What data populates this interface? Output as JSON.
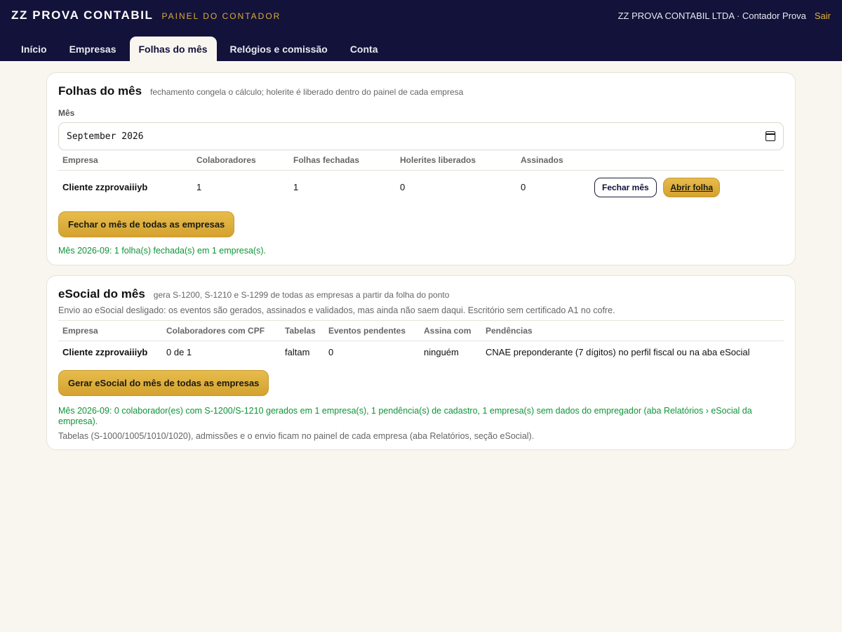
{
  "header": {
    "brand": "ZZ PROVA CONTABIL",
    "subtitle": "PAINEL DO CONTADOR",
    "user": "ZZ PROVA CONTABIL LTDA · Contador Prova",
    "logout": "Sair"
  },
  "tabs": [
    {
      "label": "Início"
    },
    {
      "label": "Empresas"
    },
    {
      "label": "Folhas do mês"
    },
    {
      "label": "Relógios e comissão"
    },
    {
      "label": "Conta"
    }
  ],
  "folhas": {
    "title": "Folhas do mês",
    "hint": "fechamento congela o cálculo; holerite é liberado dentro do painel de cada empresa",
    "month_label": "Mês",
    "month_value": "September 2026",
    "columns": [
      "Empresa",
      "Colaboradores",
      "Folhas fechadas",
      "Holerites liberados",
      "Assinados"
    ],
    "row": {
      "empresa": "Cliente zzprovaiiiyb",
      "colaboradores": "1",
      "folhas_fechadas": "1",
      "holerites": "0",
      "assinados": "0",
      "close_button": "Fechar mês",
      "open_button": "Abrir folha"
    },
    "close_all_button": "Fechar o mês de todas as empresas",
    "status": "Mês 2026-09: 1 folha(s) fechada(s) em 1 empresa(s)."
  },
  "esocial": {
    "title": "eSocial do mês",
    "hint": "gera S-1200, S-1210 e S-1299 de todas as empresas a partir da folha do ponto",
    "notice": "Envio ao eSocial desligado: os eventos são gerados, assinados e validados, mas ainda não saem daqui. Escritório sem certificado A1 no cofre.",
    "columns": [
      "Empresa",
      "Colaboradores com CPF",
      "Tabelas",
      "Eventos pendentes",
      "Assina com",
      "Pendências"
    ],
    "row": {
      "empresa": "Cliente zzprovaiiiyb",
      "cpf": "0 de 1",
      "tabelas": "faltam",
      "eventos": "0",
      "assina": "ninguém",
      "pendencias": "CNAE preponderante (7 dígitos) no perfil fiscal ou na aba eSocial"
    },
    "generate_button": "Gerar eSocial do mês de todas as empresas",
    "status": "Mês 2026-09: 0 colaborador(es) com S-1200/S-1210 gerados em 1 empresa(s), 1 pendência(s) de cadastro, 1 empresa(s) sem dados do empregador (aba Relatórios › eSocial da empresa).",
    "footnote": "Tabelas (S-1000/1005/1010/1020), admissões e o envio ficam no painel de cada empresa (aba Relatórios, seção eSocial)."
  }
}
